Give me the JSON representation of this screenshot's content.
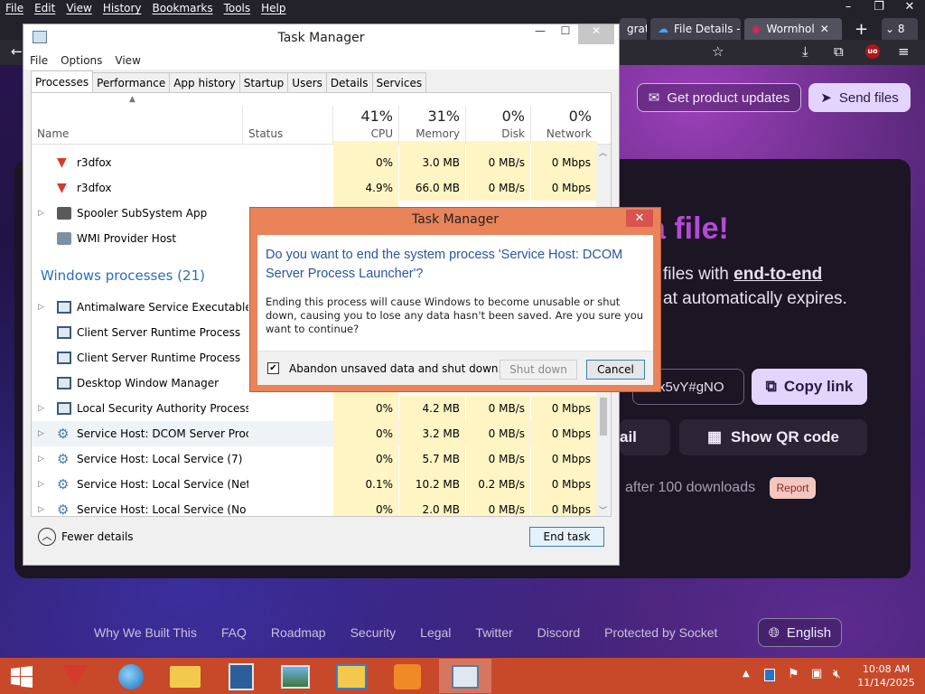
{
  "firefox": {
    "menu": [
      "File",
      "Edit",
      "View",
      "History",
      "Bookmarks",
      "Tools",
      "Help"
    ],
    "tabs": [
      {
        "label": "grat"
      },
      {
        "label": "File Details - I"
      },
      {
        "label": "Wormhol"
      }
    ],
    "new_tab": "+",
    "tab_count": "8",
    "win_controls": [
      "–",
      "❐",
      "✕"
    ]
  },
  "wormhole": {
    "get_updates": "Get product updates",
    "send_files": "Send files",
    "heading_fragment": "a file!",
    "sub_line1_prefix": "files with",
    "sub_line1_bold": "end-to-end",
    "sub_line2": "at automatically expires.",
    "link_text": "x5vY#gNO",
    "copy_link": "Copy link",
    "email_fragment": "ail",
    "show_qr": "Show QR code",
    "expiry_fragment": "after 100 downloads",
    "report": "Report",
    "footer": [
      "Why We Built This",
      "FAQ",
      "Roadmap",
      "Security",
      "Legal",
      "Twitter",
      "Discord",
      "Protected by Socket"
    ],
    "language": "English"
  },
  "taskmgr": {
    "title": "Task Manager",
    "controls": [
      "—",
      "☐",
      "✕"
    ],
    "menu": [
      "File",
      "Options",
      "View"
    ],
    "tabs": [
      "Processes",
      "Performance",
      "App history",
      "Startup",
      "Users",
      "Details",
      "Services"
    ],
    "columns": {
      "name": "Name",
      "status": "Status",
      "cpu_pct": "41%",
      "cpu": "CPU",
      "mem_pct": "31%",
      "mem": "Memory",
      "disk_pct": "0%",
      "disk": "Disk",
      "net_pct": "0%",
      "net": "Network"
    },
    "rows_top": [
      {
        "name": "r3dfox",
        "cpu": "0%",
        "mem": "3.0 MB",
        "disk": "0 MB/s",
        "net": "0 Mbps"
      },
      {
        "name": "r3dfox",
        "cpu": "4.9%",
        "mem": "66.0 MB",
        "disk": "0 MB/s",
        "net": "0 Mbps"
      },
      {
        "name": "Spooler SubSystem App",
        "cpu": "",
        "mem": "",
        "disk": "",
        "net": ""
      },
      {
        "name": "WMI Provider Host",
        "cpu": "",
        "mem": "",
        "disk": "",
        "net": ""
      }
    ],
    "group": "Windows processes (21)",
    "rows_win": [
      {
        "name": "Antimalware Service Executable",
        "cpu": "",
        "mem": "",
        "disk": "",
        "net": ""
      },
      {
        "name": "Client Server Runtime Process",
        "cpu": "",
        "mem": "",
        "disk": "",
        "net": ""
      },
      {
        "name": "Client Server Runtime Process",
        "cpu": "",
        "mem": "",
        "disk": "",
        "net": ""
      },
      {
        "name": "Desktop Window Manager",
        "cpu": "",
        "mem": "",
        "disk": "",
        "net": ""
      },
      {
        "name": "Local Security Authority Process...",
        "cpu": "0%",
        "mem": "4.2 MB",
        "disk": "0 MB/s",
        "net": "0 Mbps"
      },
      {
        "name": "Service Host: DCOM Server Proc...",
        "cpu": "0%",
        "mem": "3.2 MB",
        "disk": "0 MB/s",
        "net": "0 Mbps"
      },
      {
        "name": "Service Host: Local Service (7)",
        "cpu": "0%",
        "mem": "5.7 MB",
        "disk": "0 MB/s",
        "net": "0 Mbps"
      },
      {
        "name": "Service Host: Local Service (Net...",
        "cpu": "0.1%",
        "mem": "10.2 MB",
        "disk": "0.2 MB/s",
        "net": "0 Mbps"
      },
      {
        "name": "Service Host: Local Service (No I...",
        "cpu": "0%",
        "mem": "2.0 MB",
        "disk": "0 MB/s",
        "net": "0 Mbps"
      }
    ],
    "fewer_details": "Fewer details",
    "end_task": "End task"
  },
  "dialog": {
    "title": "Task Manager",
    "question": "Do you want to end the system process 'Service Host: DCOM Server Process Launcher'?",
    "detail": "Ending this process will cause Windows to become unusable or shut down, causing you to lose any data hasn't been saved. Are you sure you want to continue?",
    "checkbox_label": "Abandon unsaved data and shut down.",
    "checkbox_checked": true,
    "shutdown": "Shut down",
    "cancel": "Cancel"
  },
  "taskbar": {
    "time": "10:08 AM",
    "date": "11/14/2025"
  }
}
